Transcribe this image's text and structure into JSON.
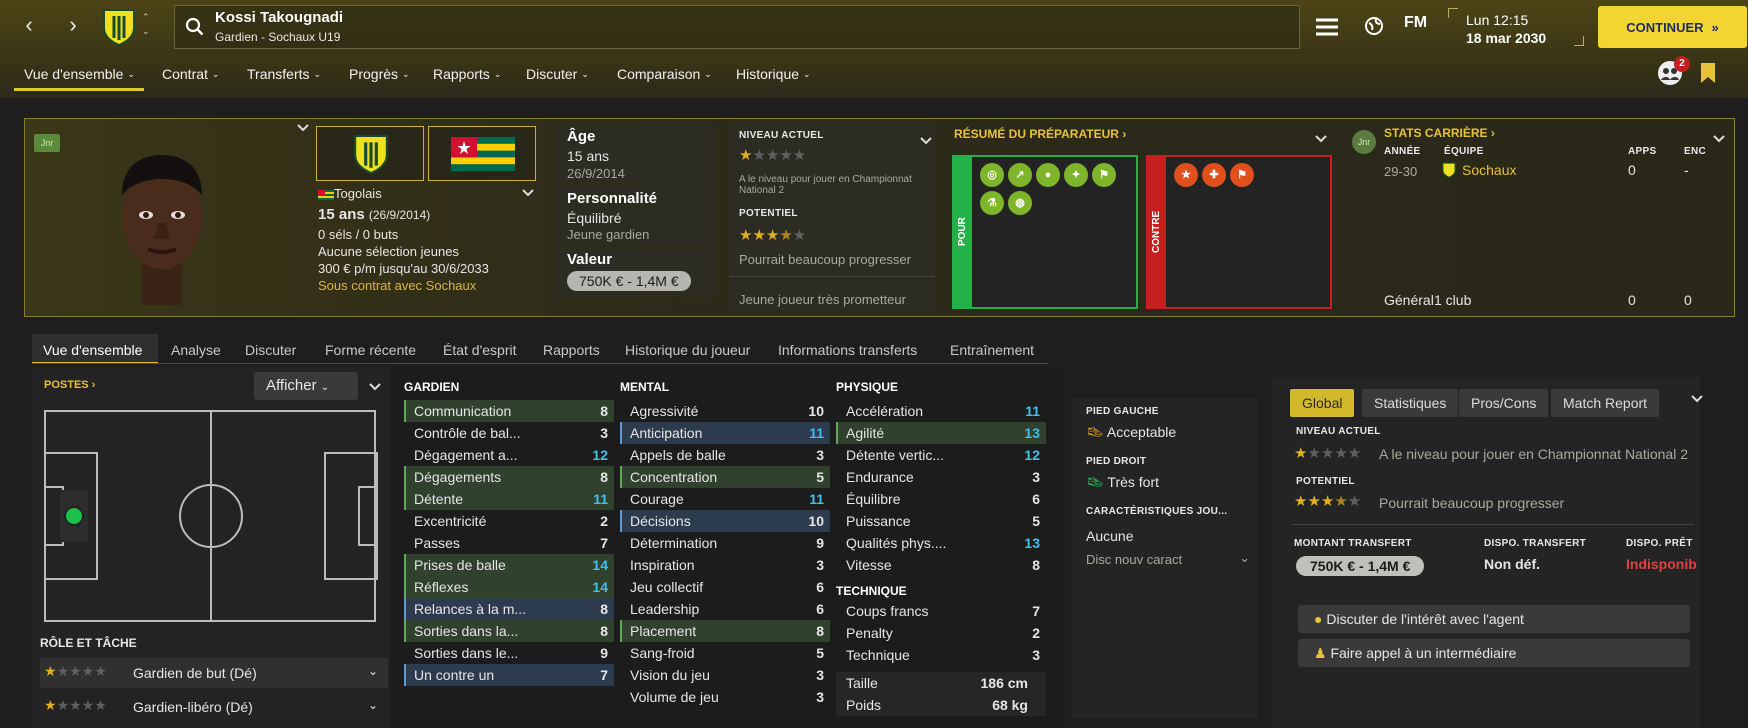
{
  "header": {
    "player_name": "Kossi Takougnadi",
    "player_sub": "Gardien - Sochaux U19",
    "date_time": "Lun 12:15",
    "date_day": "18 mar 2030",
    "continue_label": "CONTINUER",
    "fm_label": "FM",
    "notif_count": "2"
  },
  "menu": [
    "Vue d'ensemble",
    "Contrat",
    "Transferts",
    "Progrès",
    "Rapports",
    "Discuter",
    "Comparaison",
    "Historique"
  ],
  "profile": {
    "jnr": "Jnr",
    "nationality": "Togolais",
    "age_main": "15 ans",
    "age_date": "(26/9/2014)",
    "caps": "0 séls / 0 buts",
    "youth": "Aucune sélection jeunes",
    "wage": "300 € p/m jusqu'au 30/6/2033",
    "contract": "Sous contrat avec Sochaux",
    "age_label": "Âge",
    "age_value": "15 ans",
    "birth": "26/9/2014",
    "personality_label": "Personnalité",
    "personality": "Équilibré",
    "personality_sub": "Jeune gardien",
    "value_label": "Valeur",
    "value": "750K € - 1,4M €"
  },
  "level": {
    "current_label": "NIVEAU ACTUEL",
    "current_stars": 1,
    "current_text": "A le niveau pour jouer en Championnat National 2",
    "potential_label": "POTENTIEL",
    "potential_stars": 3.5,
    "potential_text": "Pourrait beaucoup progresser",
    "footer": "Jeune joueur très prometteur"
  },
  "prep": {
    "title": "RÉSUMÉ DU PRÉPARATEUR",
    "pour": "POUR",
    "contre": "CONTRE"
  },
  "career": {
    "title": "STATS CARRIÈRE",
    "jnr": "Jnr",
    "col_year": "ANNÉE",
    "col_team": "ÉQUIPE",
    "col_apps": "APPS",
    "col_enc": "ENC",
    "year": "29-30",
    "team": "Sochaux",
    "apps": "0",
    "enc": "-",
    "total_label": "Général",
    "total_clubs": "1 club",
    "total_apps": "0",
    "total_enc": "0"
  },
  "subtabs": [
    "Vue d'ensemble",
    "Analyse",
    "Discuter",
    "Forme récente",
    "État d'esprit",
    "Rapports",
    "Historique du joueur",
    "Informations transferts",
    "Entraînement"
  ],
  "positions": {
    "title": "POSTES",
    "show_label": "Afficher",
    "role_title": "RÔLE ET TÂCHE",
    "roles": [
      {
        "name": "Gardien de but (Dé)",
        "stars": 1
      },
      {
        "name": "Gardien-libéro (Dé)",
        "stars": 1
      }
    ]
  },
  "attributes": {
    "gardien_title": "GARDIEN",
    "gardien": [
      {
        "n": "Communication",
        "v": "8",
        "h": "g"
      },
      {
        "n": "Contrôle de bal...",
        "v": "3",
        "h": ""
      },
      {
        "n": "Dégagement a...",
        "v": "12",
        "h": ""
      },
      {
        "n": "Dégagements",
        "v": "8",
        "h": "g"
      },
      {
        "n": "Détente",
        "v": "11",
        "h": "g"
      },
      {
        "n": "Excentricité",
        "v": "2",
        "h": ""
      },
      {
        "n": "Passes",
        "v": "7",
        "h": ""
      },
      {
        "n": "Prises de balle",
        "v": "14",
        "h": "g"
      },
      {
        "n": "Réflexes",
        "v": "14",
        "h": "g"
      },
      {
        "n": "Relances à la m...",
        "v": "8",
        "h": "b"
      },
      {
        "n": "Sorties dans la...",
        "v": "8",
        "h": "g"
      },
      {
        "n": "Sorties dans le...",
        "v": "9",
        "h": ""
      },
      {
        "n": "Un contre un",
        "v": "7",
        "h": "b"
      }
    ],
    "mental_title": "MENTAL",
    "mental": [
      {
        "n": "Agressivité",
        "v": "10",
        "h": ""
      },
      {
        "n": "Anticipation",
        "v": "11",
        "h": "b"
      },
      {
        "n": "Appels de balle",
        "v": "3",
        "h": ""
      },
      {
        "n": "Concentration",
        "v": "5",
        "h": "g"
      },
      {
        "n": "Courage",
        "v": "11",
        "h": ""
      },
      {
        "n": "Décisions",
        "v": "10",
        "h": "b"
      },
      {
        "n": "Détermination",
        "v": "9",
        "h": ""
      },
      {
        "n": "Inspiration",
        "v": "3",
        "h": ""
      },
      {
        "n": "Jeu collectif",
        "v": "6",
        "h": ""
      },
      {
        "n": "Leadership",
        "v": "6",
        "h": ""
      },
      {
        "n": "Placement",
        "v": "8",
        "h": "g"
      },
      {
        "n": "Sang-froid",
        "v": "5",
        "h": ""
      },
      {
        "n": "Vision du jeu",
        "v": "3",
        "h": ""
      },
      {
        "n": "Volume de jeu",
        "v": "3",
        "h": ""
      }
    ],
    "physique_title": "PHYSIQUE",
    "physique": [
      {
        "n": "Accélération",
        "v": "11",
        "h": ""
      },
      {
        "n": "Agilité",
        "v": "13",
        "h": "g"
      },
      {
        "n": "Détente vertic...",
        "v": "12",
        "h": ""
      },
      {
        "n": "Endurance",
        "v": "3",
        "h": ""
      },
      {
        "n": "Équilibre",
        "v": "6",
        "h": ""
      },
      {
        "n": "Puissance",
        "v": "5",
        "h": ""
      },
      {
        "n": "Qualités phys....",
        "v": "13",
        "h": ""
      },
      {
        "n": "Vitesse",
        "v": "8",
        "h": ""
      }
    ],
    "technique_title": "TECHNIQUE",
    "technique": [
      {
        "n": "Coups francs",
        "v": "7",
        "h": ""
      },
      {
        "n": "Penalty",
        "v": "2",
        "h": ""
      },
      {
        "n": "Technique",
        "v": "3",
        "h": ""
      }
    ],
    "height_label": "Taille",
    "height": "186 cm",
    "weight_label": "Poids",
    "weight": "68 kg"
  },
  "feet": {
    "left_label": "PIED GAUCHE",
    "left": "Acceptable",
    "right_label": "PIED DROIT",
    "right": "Très fort",
    "traits_label": "CARACTÉRISTIQUES JOU...",
    "traits": "Aucune",
    "traits_select": "Disc nouv caract"
  },
  "report": {
    "tabs": [
      "Global",
      "Statistiques",
      "Pros/Cons",
      "Match Report"
    ],
    "current_label": "NIVEAU ACTUEL",
    "current_text": "A le niveau pour jouer en Championnat National 2",
    "potential_label": "POTENTIEL",
    "potential_text": "Pourrait beaucoup progresser",
    "transfer_label": "MONTANT TRANSFERT",
    "transfer": "750K € - 1,4M €",
    "dispo_t_label": "DISPO. TRANSFERT",
    "dispo_t": "Non déf.",
    "dispo_p_label": "DISPO. PRÊT",
    "dispo_p": "Indisponib",
    "btn1": "Discuter de l'intérêt avec l'agent",
    "btn2": "Faire appel à un intermédiaire"
  },
  "colors": {
    "accent": "#f3d531",
    "green": "#23b24a",
    "red": "#c42020"
  }
}
